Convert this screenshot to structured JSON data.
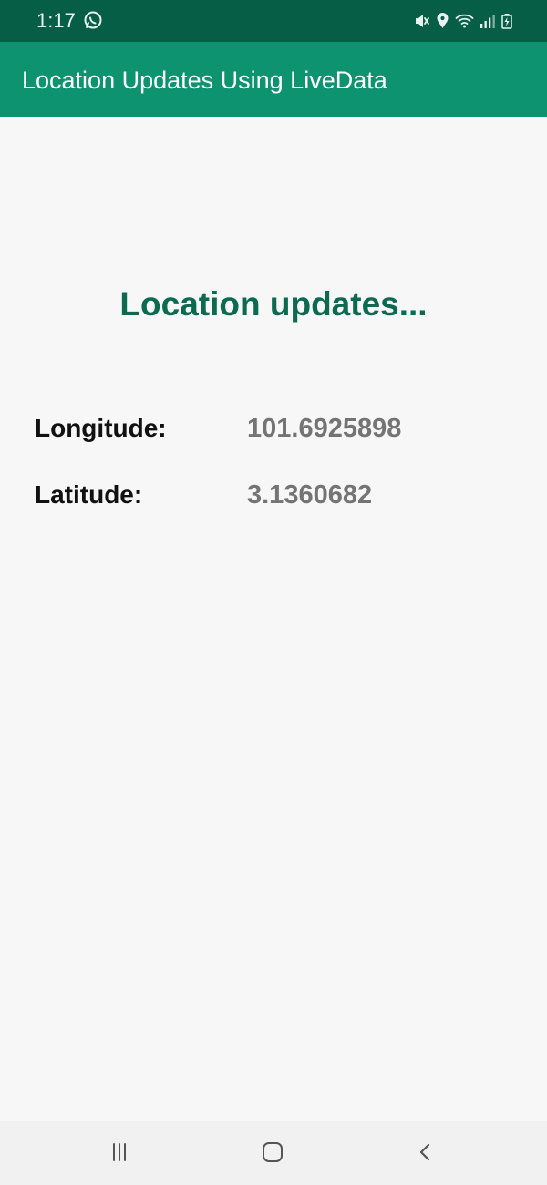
{
  "status_bar": {
    "time": "1:17",
    "left_icons": [
      "whatsapp-icon"
    ],
    "right_icons": [
      "mute-icon",
      "location-icon",
      "wifi-icon",
      "signal-icon",
      "battery-icon"
    ]
  },
  "app_bar": {
    "title": "Location Updates Using LiveData"
  },
  "main": {
    "heading": "Location updates...",
    "longitude": {
      "label": "Longitude:",
      "value": "101.6925898"
    },
    "latitude": {
      "label": "Latitude:",
      "value": "3.1360682"
    }
  },
  "navigation_bar": {
    "items": [
      "recent-apps-icon",
      "home-icon",
      "back-icon"
    ]
  },
  "colors": {
    "status_bar": "#075e46",
    "app_bar": "#0d9370",
    "heading": "#0b6a4f",
    "value_text": "#747474",
    "label_text": "#111111",
    "background": "#f7f7f8"
  }
}
